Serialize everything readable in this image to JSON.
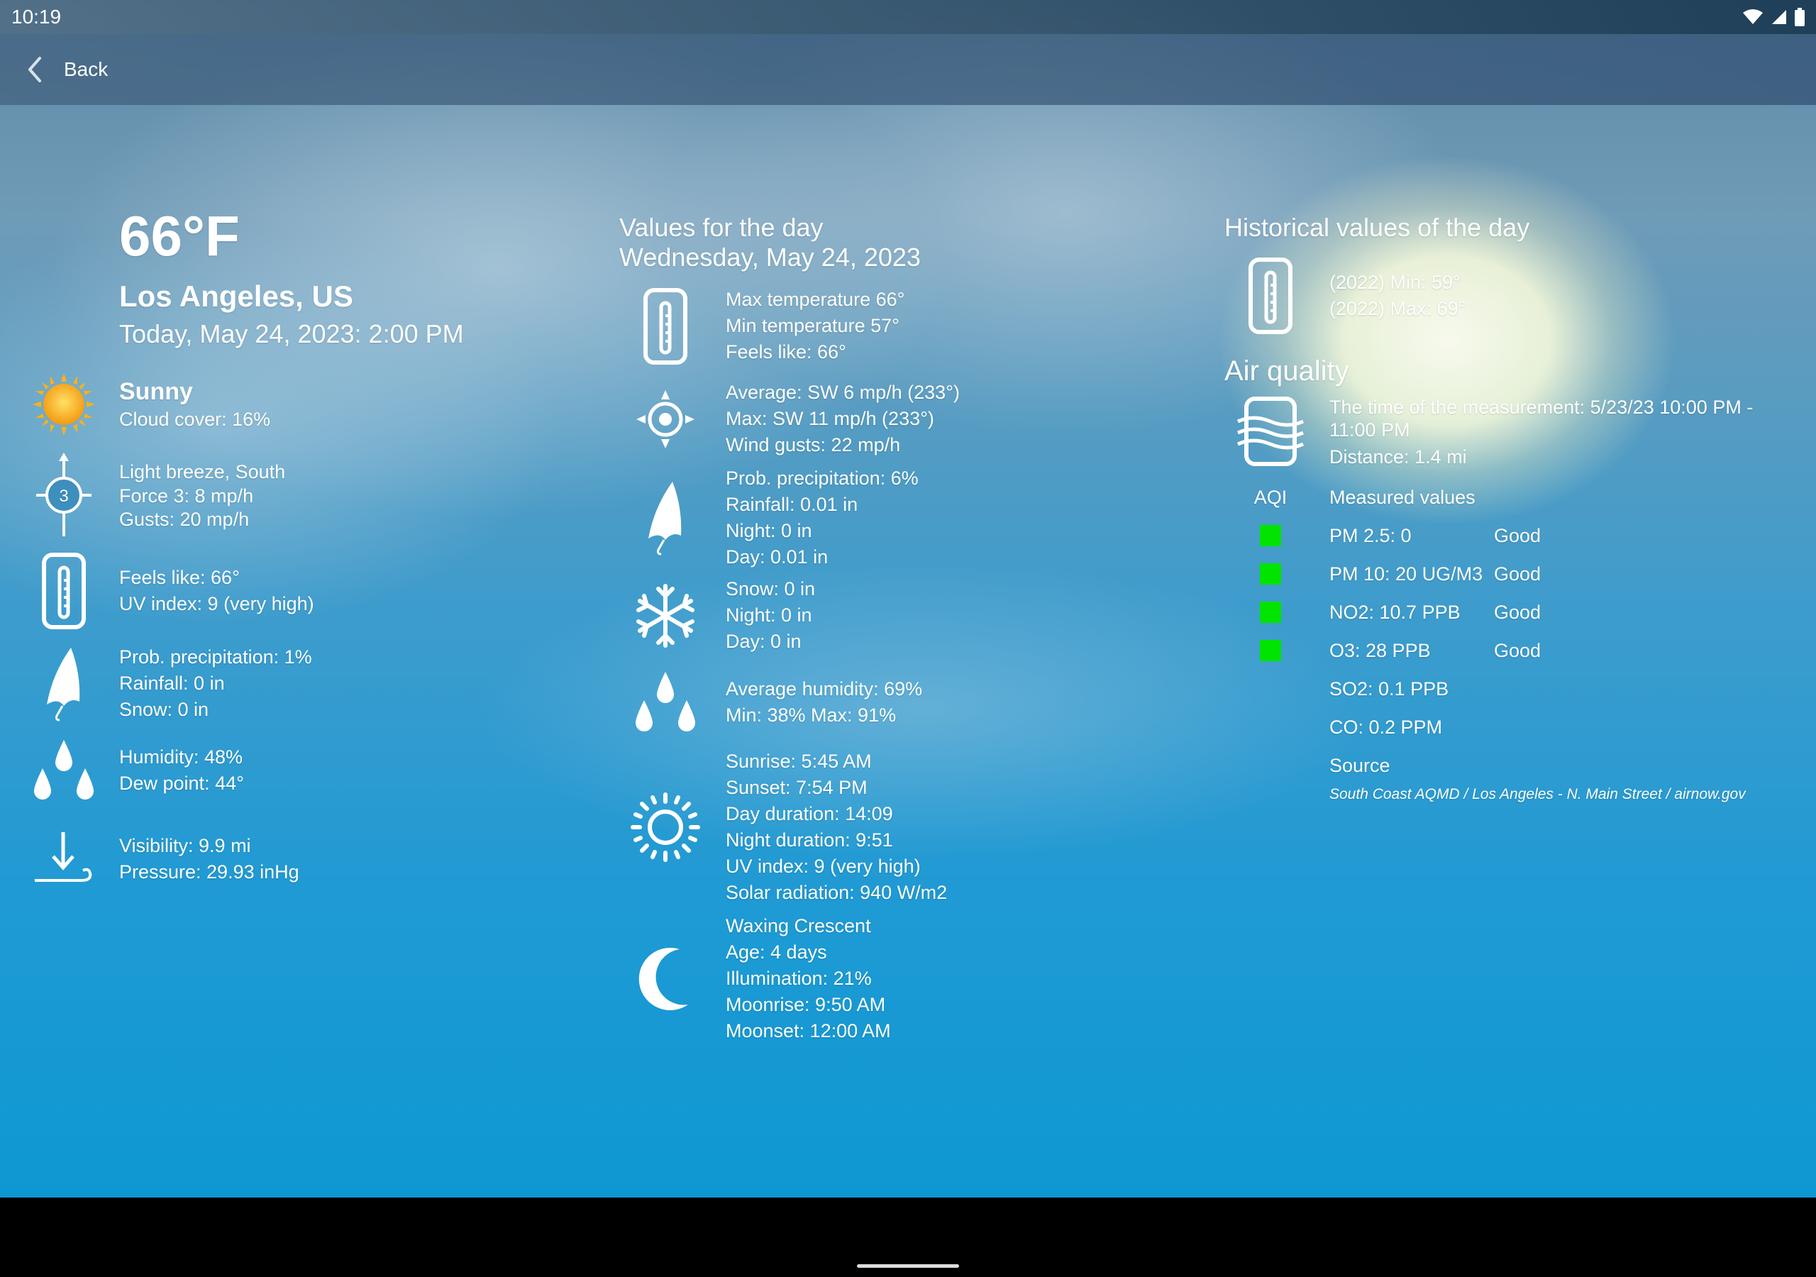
{
  "status_bar": {
    "time": "10:19",
    "icons": [
      "wifi-icon",
      "signal-icon",
      "battery-icon"
    ]
  },
  "app_bar": {
    "back_label": "Back"
  },
  "current": {
    "temperature": "66°F",
    "location": "Los Angeles, US",
    "datetime": "Today, May 24, 2023: 2:00 PM",
    "condition": "Sunny",
    "cloud_cover": "Cloud cover: 16%",
    "wind": [
      "Light breeze, South",
      "Force 3: 8 mp/h",
      "Gusts: 20 mp/h"
    ],
    "wind_force_badge": "3",
    "feels": [
      "Feels like: 66°",
      "UV index: 9 (very high)"
    ],
    "precip": [
      "Prob. precipitation: 1%",
      "Rainfall: 0 in",
      "Snow: 0 in"
    ],
    "humidity": [
      "Humidity: 48%",
      "Dew point: 44°"
    ],
    "visibility": [
      "Visibility: 9.9 mi",
      "Pressure: 29.93 inHg"
    ]
  },
  "day_values": {
    "title_line1": "Values for the day",
    "title_line2": "Wednesday, May 24, 2023",
    "temperature": [
      "Max temperature 66°",
      "Min temperature 57°",
      "Feels like: 66°"
    ],
    "wind": [
      "Average: SW 6 mp/h (233°)",
      "Max: SW 11 mp/h (233°)",
      "Wind gusts: 22 mp/h"
    ],
    "precip": [
      "Prob. precipitation: 6%",
      "Rainfall: 0.01 in",
      "Night: 0 in",
      "Day: 0.01 in"
    ],
    "snow": [
      "Snow: 0 in",
      "Night: 0 in",
      "Day: 0 in"
    ],
    "humidity": [
      "Average humidity: 69%",
      "Min: 38% Max: 91%"
    ],
    "sun": [
      "Sunrise: 5:45 AM",
      "Sunset: 7:54 PM",
      "Day duration: 14:09",
      "Night duration: 9:51",
      "UV index: 9 (very high)",
      "Solar radiation: 940 W/m2"
    ],
    "moon": [
      "Waxing Crescent",
      "Age: 4 days",
      "Illumination: 21%",
      "Moonrise: 9:50 AM",
      "Moonset: 12:00 AM"
    ]
  },
  "historical": {
    "title": "Historical values of the day",
    "values": [
      "(2022) Min: 59°",
      "(2022) Max: 69°"
    ]
  },
  "air_quality": {
    "title": "Air quality",
    "measurement_time": "The time of the measurement: 5/23/23 10:00 PM - 11:00 PM",
    "distance": "Distance: 1.4 mi",
    "aqi_header": "AQI",
    "values_header": "Measured values",
    "rows": [
      {
        "value": "PM 2.5: 0",
        "status": "Good",
        "color": "#00e400"
      },
      {
        "value": "PM 10: 20 UG/M3",
        "status": "Good",
        "color": "#00e400"
      },
      {
        "value": "NO2: 10.7 PPB",
        "status": "Good",
        "color": "#00e400"
      },
      {
        "value": "O3: 28 PPB",
        "status": "Good",
        "color": "#00e400"
      },
      {
        "value": "SO2: 0.1 PPB",
        "status": "",
        "color": ""
      },
      {
        "value": "CO: 0.2 PPM",
        "status": "",
        "color": ""
      }
    ],
    "source_label": "Source",
    "source_text": "South Coast AQMD / Los Angeles - N. Main Street / airnow.gov"
  }
}
